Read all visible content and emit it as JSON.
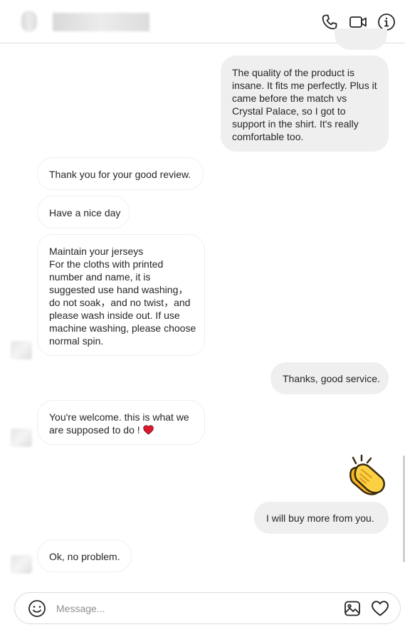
{
  "header": {
    "contact_name": "",
    "call_icon": "phone-icon",
    "video_icon": "video-camera-icon",
    "info_icon": "info-icon"
  },
  "messages": [
    {
      "sender": "me",
      "text": "The quality of the product is insane. It fits me perfectly. Plus it came before the match vs Crystal Palace, so I got to support in the shirt. It's really comfortable too."
    },
    {
      "sender": "them",
      "text": "Thank you for your good review."
    },
    {
      "sender": "them",
      "text": "Have a nice day"
    },
    {
      "sender": "them",
      "text": "Maintain your jerseys\nFor the cloths with printed number and name, it is suggested use hand washing，do not soak，and no twist，and please wash inside out. If use machine washing, please choose normal spin."
    },
    {
      "sender": "me",
      "text": "Thanks, good service."
    },
    {
      "sender": "them",
      "text": "You're welcome. this is what we are supposed to do !",
      "emoji": "red-heart"
    },
    {
      "sender": "me",
      "emoji": "clapping-hands"
    },
    {
      "sender": "me",
      "text": "I will buy more from you."
    },
    {
      "sender": "them",
      "text": "Ok, no problem."
    }
  ],
  "composer": {
    "placeholder": "Message...",
    "emoji_icon": "smiley-icon",
    "image_icon": "image-icon",
    "like_icon": "heart-icon"
  },
  "colors": {
    "outgoing_bubble": "#efefef",
    "incoming_border": "#efefef",
    "heart": "#e0182d",
    "clap": "#f7c02e"
  }
}
